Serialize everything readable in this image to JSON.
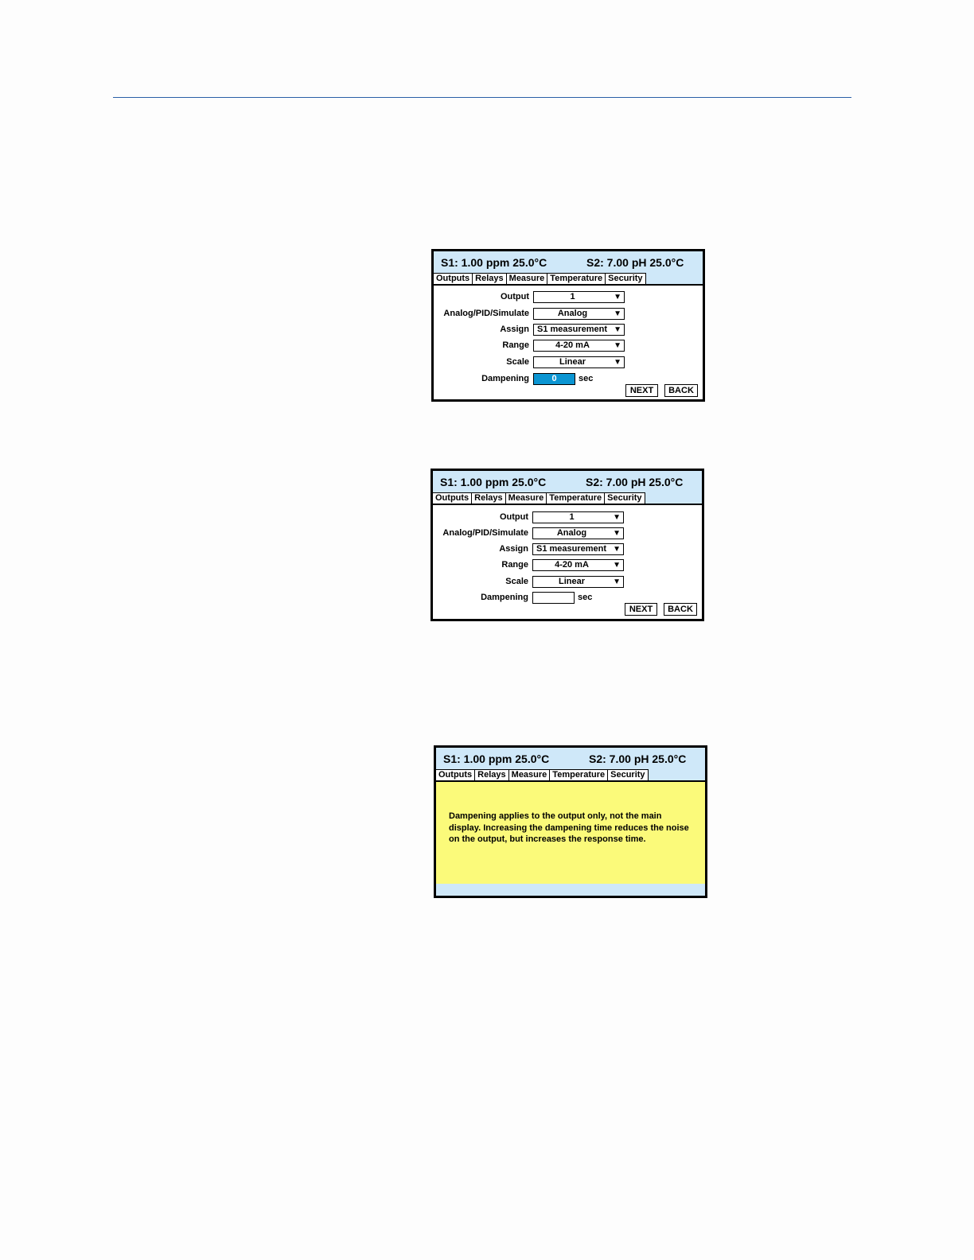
{
  "status": {
    "s1": "S1: 1.00 ppm  25.0°C",
    "s2": "S2: 7.00 pH 25.0°C"
  },
  "tabs": [
    "Outputs",
    "Relays",
    "Measure",
    "Temperature",
    "Security"
  ],
  "form": {
    "output_label": "Output",
    "output_value": "1",
    "mode_label": "Analog/PID/Simulate",
    "mode_value": "Analog",
    "assign_label": "Assign",
    "assign_value": "S1 measurement",
    "range_label": "Range",
    "range_value": "4-20 mA",
    "scale_label": "Scale",
    "scale_value": "Linear",
    "dampening_label": "Dampening",
    "dampening_unit": "sec",
    "arrow": "▼"
  },
  "screen1": {
    "dampening_value": "0"
  },
  "screen2": {
    "dampening_value": ""
  },
  "buttons": {
    "next": "NEXT",
    "back": "BACK"
  },
  "help": {
    "text": "Dampening applies to the output only, not the main display. Increasing the dampening time reduces the noise on the output, but increases the response time."
  }
}
